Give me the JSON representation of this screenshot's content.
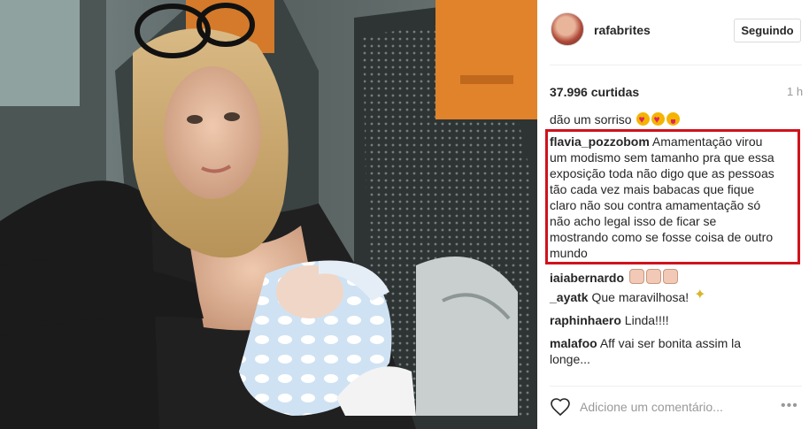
{
  "post": {
    "username": "rafabrites",
    "follow_label": "Seguindo",
    "likes": "37.996 curtidas",
    "time": "1 h",
    "caption_tail": "dão um sorriso"
  },
  "highlight_comment": {
    "user": "flavia_pozzobom",
    "lines": [
      " Amamentação virou",
      "um modismo sem tamanho pra que essa",
      "exposição toda não digo que as pessoas",
      "tão cada vez mais babacas que fique",
      "claro não sou contra amamentação só",
      "não acho legal isso de ficar se",
      "mostrando como se fosse coisa de outro",
      "mundo"
    ]
  },
  "comments": [
    {
      "user": "iaiabernardo",
      "text": ""
    },
    {
      "user": "_ayatk",
      "text": "Que maravilhosa!"
    },
    {
      "user": "raphinhaero",
      "text": "Linda!!!!"
    },
    {
      "user": "malafoo",
      "text": "Aff vai ser bonita assim la",
      "text2": "longe..."
    }
  ],
  "composer": {
    "placeholder": "Adicione um comentário...",
    "more": "•••"
  },
  "icons": {
    "like": "heart-outline-icon",
    "more": "more-options-icon"
  },
  "colors": {
    "highlight_border": "#d0121b",
    "muted": "#999999"
  }
}
